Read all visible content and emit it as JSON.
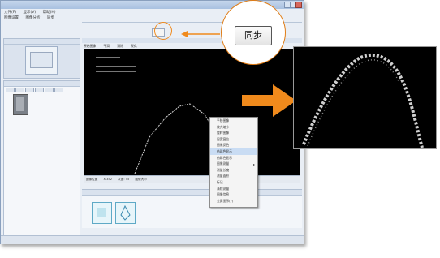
{
  "sync": {
    "label": "同步"
  },
  "menu": {
    "row1": [
      "文件(F)",
      "显示(V)",
      "帮助(H)"
    ],
    "row2": [
      "图像设置",
      "图像分析",
      "同步"
    ]
  },
  "viewer_toolbar": [
    "原始图像",
    "平滑",
    "清除",
    "锐化"
  ],
  "viewer_statusbar": [
    "图像位置",
    "X 352",
    "灰度: 55",
    "图像大小"
  ],
  "context_menu": {
    "items": [
      "平移图像",
      "放大缩小",
      "旋转图像",
      "窗宽窗位",
      "图像反色",
      "伪彩色显示",
      "伪彩色显示",
      "图像测量",
      "测量长度",
      "测量面积",
      "标记",
      "清除测量",
      "图像信息",
      "全屏显示(F)"
    ],
    "highlighted_index": 5
  },
  "colors": {
    "accent": "#f08a1c",
    "window_border": "#8aa0be",
    "highlight": "#c9dcf3"
  },
  "icons": [
    "right-arrow-icon",
    "left-arrow-icon",
    "submenu-arrow-icon"
  ]
}
